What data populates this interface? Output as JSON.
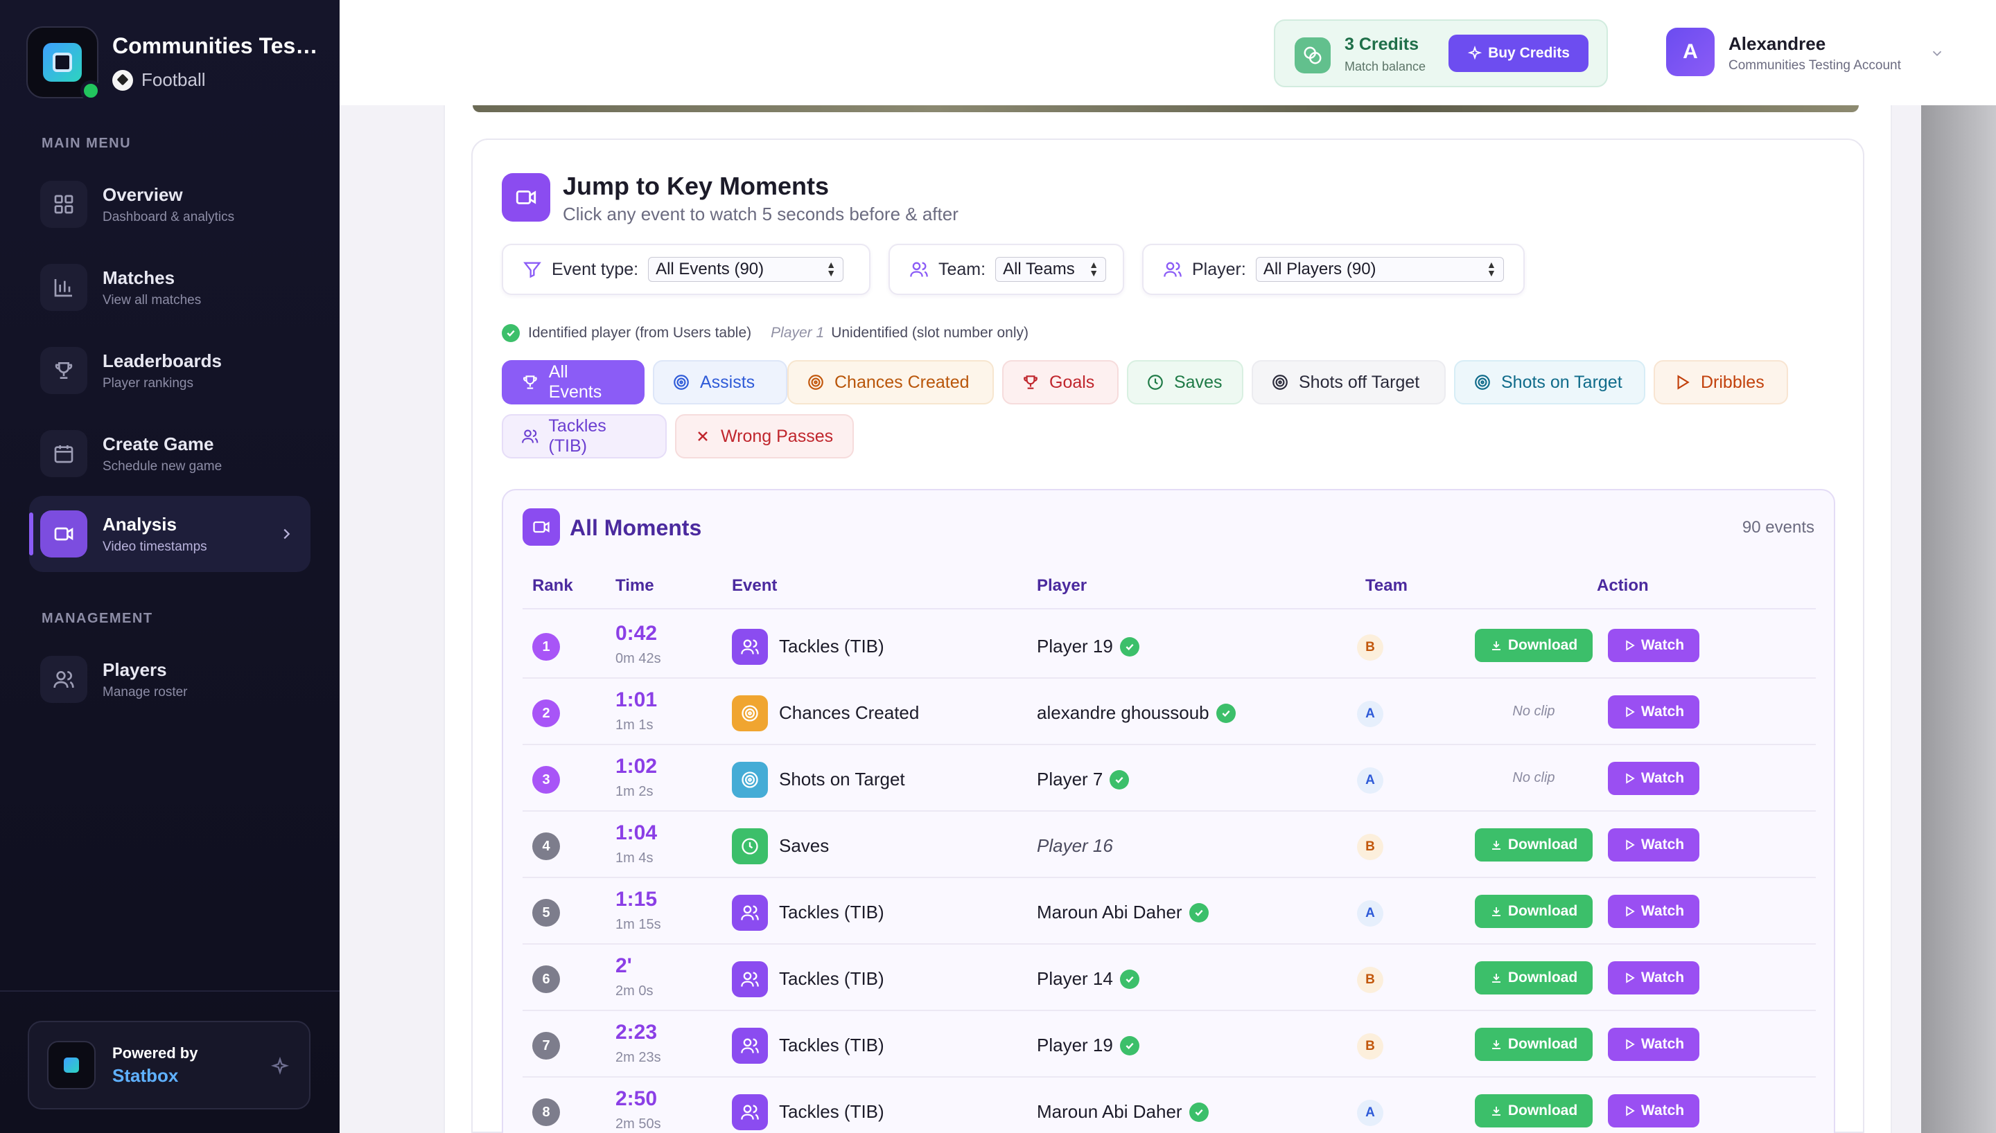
{
  "org": {
    "name": "Communities Testing",
    "sport": "Football"
  },
  "menu": {
    "main_label": "MAIN MENU",
    "management_label": "MANAGEMENT",
    "items": [
      {
        "title": "Overview",
        "sub": "Dashboard & analytics"
      },
      {
        "title": "Matches",
        "sub": "View all matches"
      },
      {
        "title": "Leaderboards",
        "sub": "Player rankings"
      },
      {
        "title": "Create Game",
        "sub": "Schedule new game"
      },
      {
        "title": "Analysis",
        "sub": "Video timestamps"
      }
    ],
    "management_items": [
      {
        "title": "Players",
        "sub": "Manage roster"
      }
    ]
  },
  "powered": {
    "line1": "Powered by",
    "line2": "Statbox"
  },
  "credits": {
    "title": "3 Credits",
    "sub": "Match balance",
    "buy_label": "Buy Credits"
  },
  "user": {
    "initial": "A",
    "name": "Alexandree",
    "account": "Communities Testing Account"
  },
  "section": {
    "title": "Jump to Key Moments",
    "subtitle": "Click any event to watch 5 seconds before & after"
  },
  "filters": {
    "event_type": {
      "label": "Event type:",
      "value": "All Events (90)"
    },
    "team": {
      "label": "Team:",
      "value": "All Teams"
    },
    "player": {
      "label": "Player:",
      "value": "All Players (90)"
    }
  },
  "legend": {
    "identified": "Identified player (from Users table)",
    "player_example": "Player 1",
    "unidentified": "Unidentified (slot number only)"
  },
  "chips": [
    {
      "label": "All Events",
      "icon": "trophy-icon"
    },
    {
      "label": "Assists",
      "icon": "target-icon"
    },
    {
      "label": "Chances Created",
      "icon": "target-icon"
    },
    {
      "label": "Goals",
      "icon": "trophy-icon"
    },
    {
      "label": "Saves",
      "icon": "clock-icon"
    },
    {
      "label": "Shots off Target",
      "icon": "target-icon"
    },
    {
      "label": "Shots on Target",
      "icon": "target-icon"
    },
    {
      "label": "Dribbles",
      "icon": "play-icon"
    },
    {
      "label": "Tackles (TIB)",
      "icon": "users-icon"
    },
    {
      "label": "Wrong Passes",
      "icon": "x-icon"
    }
  ],
  "colors": {
    "accent": "#8b5cf6",
    "download": "#3cbf6a",
    "watch": "#9a4ff2",
    "rank_top": "#a855f7",
    "rank_other": "#7d7d8c"
  },
  "moments": {
    "title": "All Moments",
    "count": "90 events",
    "headers": {
      "rank": "Rank",
      "time": "Time",
      "event": "Event",
      "player": "Player",
      "team": "Team",
      "action": "Action"
    },
    "download_label": "Download",
    "watch_label": "Watch",
    "noclip_label": "No clip",
    "rows": [
      {
        "rank": "1",
        "time": "0:42",
        "sub": "0m 42s",
        "event": "Tackles (TIB)",
        "player": "Player 19",
        "verified": true,
        "team": "B",
        "has_clip": true
      },
      {
        "rank": "2",
        "time": "1:01",
        "sub": "1m 1s",
        "event": "Chances Created",
        "player": "alexandre ghoussoub",
        "verified": true,
        "team": "A",
        "has_clip": false
      },
      {
        "rank": "3",
        "time": "1:02",
        "sub": "1m 2s",
        "event": "Shots on Target",
        "player": "Player 7",
        "verified": true,
        "team": "A",
        "has_clip": false
      },
      {
        "rank": "4",
        "time": "1:04",
        "sub": "1m 4s",
        "event": "Saves",
        "player": "Player 16",
        "verified": false,
        "team": "B",
        "has_clip": true
      },
      {
        "rank": "5",
        "time": "1:15",
        "sub": "1m 15s",
        "event": "Tackles (TIB)",
        "player": "Maroun Abi Daher",
        "verified": true,
        "team": "A",
        "has_clip": true
      },
      {
        "rank": "6",
        "time": "2'",
        "sub": "2m 0s",
        "event": "Tackles (TIB)",
        "player": "Player 14",
        "verified": true,
        "team": "B",
        "has_clip": true
      },
      {
        "rank": "7",
        "time": "2:23",
        "sub": "2m 23s",
        "event": "Tackles (TIB)",
        "player": "Player 19",
        "verified": true,
        "team": "B",
        "has_clip": true
      },
      {
        "rank": "8",
        "time": "2:50",
        "sub": "2m 50s",
        "event": "Tackles (TIB)",
        "player": "Maroun Abi Daher",
        "verified": true,
        "team": "A",
        "has_clip": true
      }
    ]
  }
}
